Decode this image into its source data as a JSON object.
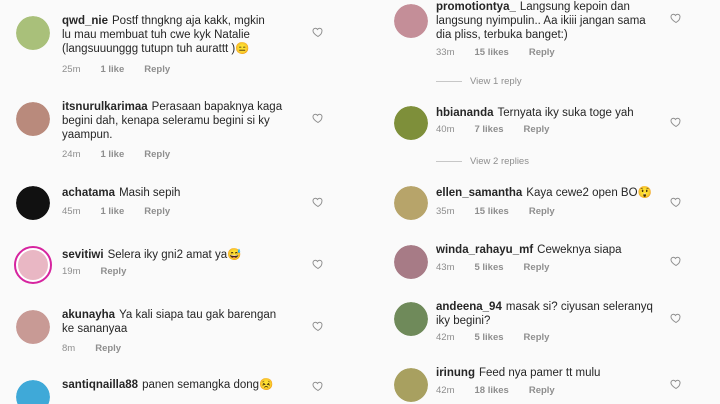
{
  "left_comments": [
    {
      "user": "qwd_nie",
      "text": "Postf thngkng aja kakk, mgkin\nlu mau membuat tuh cwe kyk Natalie\n(langsuuunggg tutupn tuh aurattt )😑",
      "time": "25m",
      "likes": "1 like",
      "reply": "Reply",
      "avatar_color": "#a9c07a"
    },
    {
      "user": "itsnurulkarimaa",
      "text": "Perasaan bapaknya kaga\nbegini dah, kenapa seleramu begini si ky\nyaampun.",
      "time": "24m",
      "likes": "1 like",
      "reply": "Reply",
      "avatar_color": "#b98a7c"
    },
    {
      "user": "achatama",
      "text": "Masih sepih",
      "time": "45m",
      "likes": "1 like",
      "reply": "Reply",
      "avatar_color": "#111111"
    },
    {
      "user": "sevitiwi",
      "text": "Selera iky gni2 amat ya😅",
      "time": "19m",
      "likes": "",
      "reply": "Reply",
      "avatar_color": "#e9b7c4"
    },
    {
      "user": "akunayha",
      "text": "Ya kali siapa tau gak barengan\nke sananyaa",
      "time": "8m",
      "likes": "",
      "reply": "Reply",
      "avatar_color": "#c89a95"
    },
    {
      "user": "santiqnailla88",
      "text": "panen semangka dong😣",
      "time": "",
      "likes": "",
      "reply": "",
      "avatar_color": "#3fa9d8"
    }
  ],
  "right_comments": [
    {
      "user": "promotiontya_",
      "text": "Langsung kepoin dan\nlangsung nyimpulin.. Aa ikiii jangan sama\ndia pliss, terbuka banget:)",
      "time": "33m",
      "likes": "15 likes",
      "reply": "Reply",
      "avatar_color": "#c48e98"
    },
    {
      "user": "hbiananda",
      "text": "Ternyata iky suka toge yah",
      "time": "40m",
      "likes": "7 likes",
      "reply": "Reply",
      "avatar_color": "#7e8f3a"
    },
    {
      "user": "ellen_samantha",
      "text": "Kaya cewe2 open BO😲",
      "time": "35m",
      "likes": "15 likes",
      "reply": "Reply",
      "avatar_color": "#b7a46a"
    },
    {
      "user": "winda_rahayu_mf",
      "text": "Ceweknya siapa",
      "time": "43m",
      "likes": "5 likes",
      "reply": "Reply",
      "avatar_color": "#a77b86"
    },
    {
      "user": "andeena_94",
      "text": "masak si? ciyusan seleranyq\niky begini?",
      "time": "42m",
      "likes": "5 likes",
      "reply": "Reply",
      "avatar_color": "#6f8a5a"
    },
    {
      "user": "irinung",
      "text": "Feed nya pamer tt mulu",
      "time": "42m",
      "likes": "18 likes",
      "reply": "Reply",
      "avatar_color": "#a8a060"
    }
  ],
  "view_replies": [
    "View 1 reply",
    "View 2 replies"
  ]
}
